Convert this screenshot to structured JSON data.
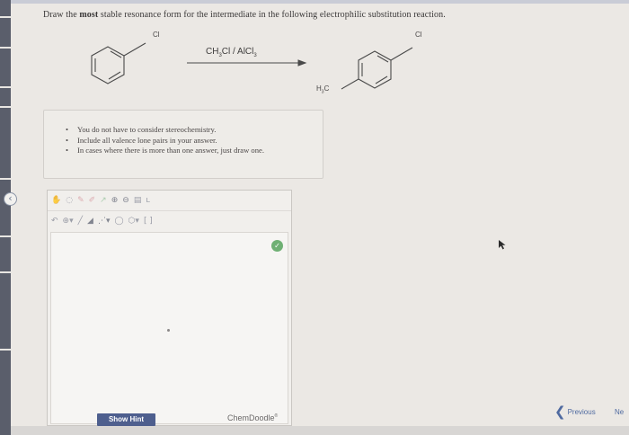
{
  "question": {
    "prefix": "Draw the ",
    "emphasis": "most",
    "suffix": " stable resonance form for the intermediate in the following electrophilic substitution reaction."
  },
  "reaction": {
    "reactant_label": "Cl",
    "reagent_main": "CH",
    "reagent_sub1": "3",
    "reagent_mid": "Cl / AlCl",
    "reagent_sub2": "3",
    "product_top_label": "Cl",
    "product_methyl_main": "H",
    "product_methyl_sub": "3",
    "product_methyl_end": "C"
  },
  "notes": [
    "You do not have to consider stereochemistry.",
    "Include all valence lone pairs in your answer.",
    "In cases where there is more than one answer, just draw one."
  ],
  "editor": {
    "brand_main": "ChemDoodle",
    "brand_sup": "®",
    "toolbar_row1": [
      "hand-tool-icon",
      "lasso-icon",
      "eraser-icon",
      "pen-icon",
      "bond-color-icon",
      "zoom-in-icon",
      "zoom-out-icon",
      "template-icon",
      "text-tool-icon"
    ],
    "toolbar_row2": [
      "undo-icon",
      "charge-icon",
      "single-bond-icon",
      "wedge-bond-icon",
      "dash-bond-icon",
      "ring-icon",
      "benzene-icon",
      "arrow-icon"
    ]
  },
  "buttons": {
    "show_hint": "Show Hint",
    "previous": "Previous",
    "next": "Ne"
  },
  "colors": {
    "hint_button": "#4e5f8e",
    "link": "#4f6aa0",
    "check_badge": "#6fb074"
  }
}
